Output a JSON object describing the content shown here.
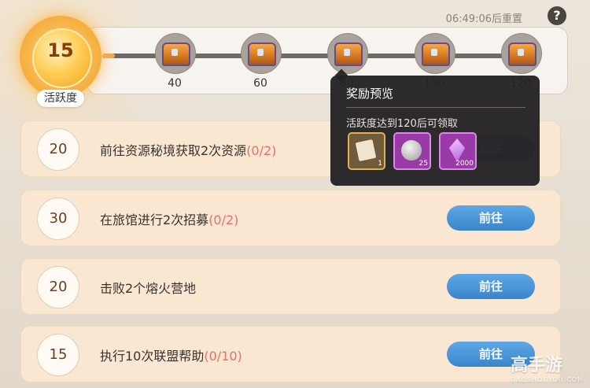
{
  "header": {
    "reset_text": "06:49:06后重置",
    "help_label": "?"
  },
  "activity": {
    "value": "15",
    "label": "活跃度",
    "progress_fraction": 0.03,
    "milestones": [
      {
        "label": "40"
      },
      {
        "label": "60"
      },
      {
        "label": "80"
      },
      {
        "label": "100"
      },
      {
        "label": "120"
      }
    ]
  },
  "tasks": [
    {
      "points": "20",
      "text": "前往资源秘境获取2次资源",
      "progress": "(0/2)",
      "button": "前往"
    },
    {
      "points": "30",
      "text": "在旅馆进行2次招募",
      "progress": "(0/2)",
      "button": "前往"
    },
    {
      "points": "20",
      "text": "击败2个熔火营地",
      "progress": "",
      "button": "前往"
    },
    {
      "points": "15",
      "text": "执行10次联盟帮助",
      "progress": "(0/10)",
      "button": "前往"
    }
  ],
  "tooltip": {
    "title": "奖励预览",
    "desc": "活跃度达到120后可领取",
    "rewards": [
      {
        "icon": "letter-scroll-icon",
        "qty": "1"
      },
      {
        "icon": "silver-coin-icon",
        "qty": "25"
      },
      {
        "icon": "purple-crystal-icon",
        "qty": "2000"
      }
    ]
  },
  "watermark": {
    "brand": "高手游",
    "domain": "GAOSHOUYOU.COM"
  }
}
